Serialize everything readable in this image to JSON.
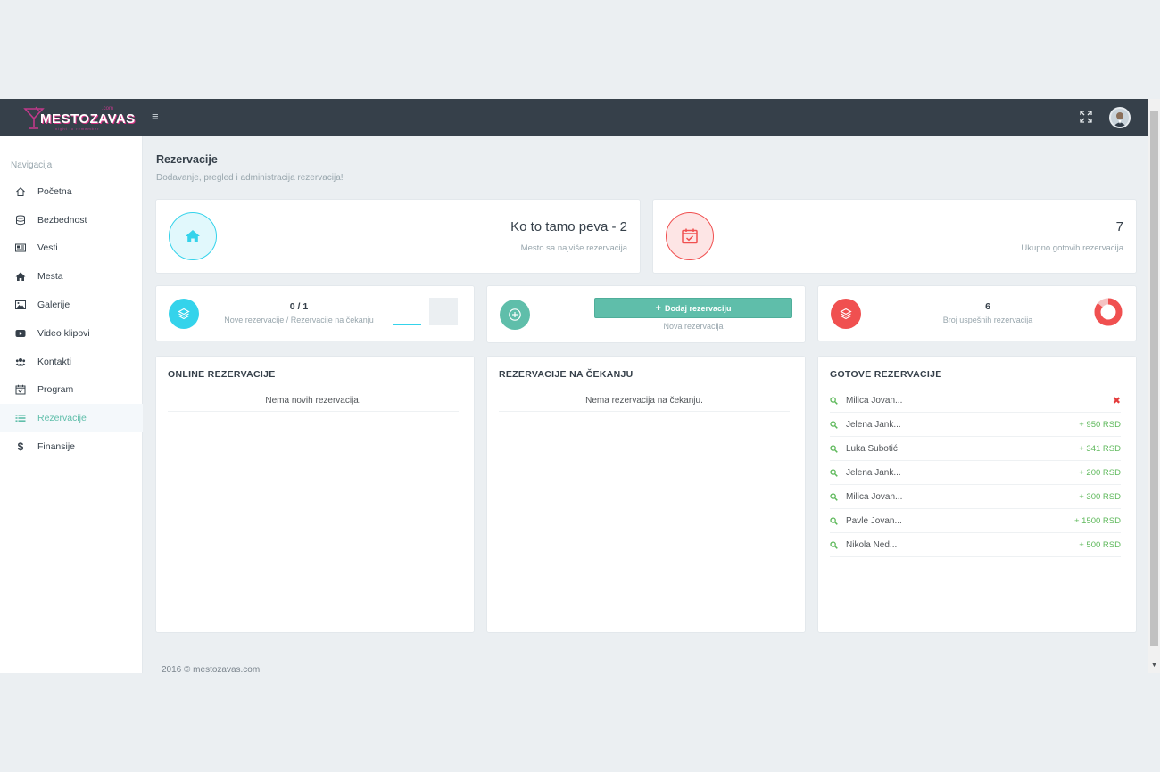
{
  "brand": {
    "name": "MESTOZAVAS",
    "suffix": ".com",
    "tagline": "night to remember"
  },
  "topbar": {
    "menu_icon": "hamburger-icon",
    "fullscreen_icon": "expand-icon",
    "avatar_icon": "user-avatar"
  },
  "sidebar": {
    "title": "Navigacija",
    "items": [
      {
        "label": "Početna",
        "icon": "home-outline-icon"
      },
      {
        "label": "Bezbednost",
        "icon": "database-icon"
      },
      {
        "label": "Vesti",
        "icon": "newspaper-icon"
      },
      {
        "label": "Mesta",
        "icon": "home-icon"
      },
      {
        "label": "Galerije",
        "icon": "image-icon"
      },
      {
        "label": "Video klipovi",
        "icon": "youtube-icon"
      },
      {
        "label": "Kontakti",
        "icon": "users-icon"
      },
      {
        "label": "Program",
        "icon": "calendar-check-icon"
      },
      {
        "label": "Rezervacije",
        "icon": "list-icon",
        "active": true
      },
      {
        "label": "Finansije",
        "icon": "dollar-icon"
      }
    ]
  },
  "page": {
    "title": "Rezervacije",
    "subtitle": "Dodavanje, pregled i administracija rezervacija!"
  },
  "stats": {
    "top_place": {
      "value": "Ko to tamo peva - 2",
      "label": "Mesto sa najviše rezervacija"
    },
    "total_done": {
      "value": "7",
      "label": "Ukupno gotovih rezervacija"
    },
    "new_pending": {
      "value": "0 / 1",
      "label": "Nove rezervacije / Rezervacije na čekanju"
    },
    "new_reservation": {
      "button": "Dodaj rezervaciju",
      "label": "Nova rezervacija"
    },
    "successful": {
      "value": "6",
      "label": "Broj uspešnih rezervacija",
      "ratio": 0.857
    }
  },
  "panels": {
    "online": {
      "title": "ONLINE REZERVACIJE",
      "empty": "Nema novih rezervacija."
    },
    "pending": {
      "title": "REZERVACIJE NA ČEKANJU",
      "empty": "Nema rezervacija na čekanju."
    },
    "done": {
      "title": "GOTOVE REZERVACIJE",
      "rows": [
        {
          "name": "Milica Jovan...",
          "amount": "",
          "cancelled": true
        },
        {
          "name": "Jelena Jank...",
          "amount": "+ 950 RSD"
        },
        {
          "name": "Luka Subotić",
          "amount": "+ 341 RSD"
        },
        {
          "name": "Jelena Jank...",
          "amount": "+ 200 RSD"
        },
        {
          "name": "Milica Jovan...",
          "amount": "+ 300 RSD"
        },
        {
          "name": "Pavle Jovan...",
          "amount": "+ 1500 RSD"
        },
        {
          "name": "Nikola Ned...",
          "amount": "+ 500 RSD"
        }
      ]
    }
  },
  "footer": {
    "text": "2016 © mestozavas.com"
  },
  "colors": {
    "topbar": "#36404a",
    "accent": "#5fbeaa",
    "info": "#34d3eb",
    "danger": "#f05050",
    "success_text": "#5fb95c"
  }
}
